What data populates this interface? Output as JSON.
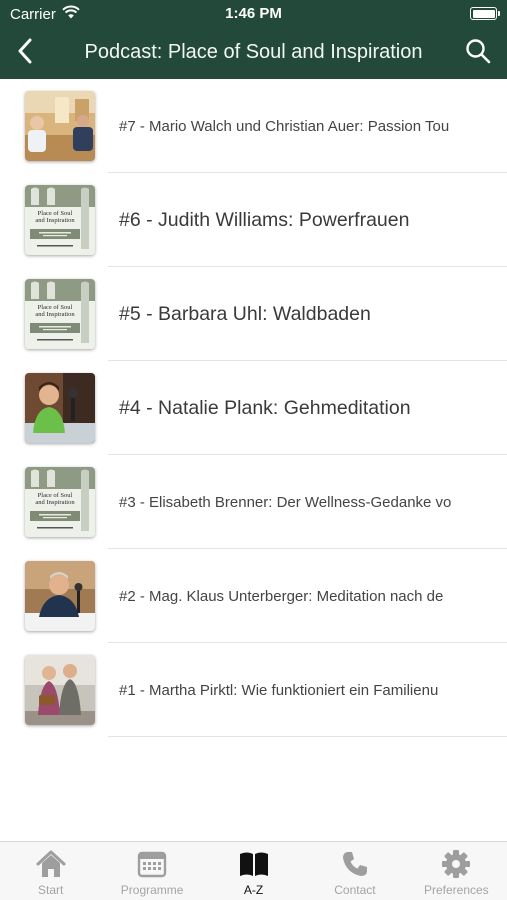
{
  "status_bar": {
    "carrier": "Carrier",
    "time": "1:46 PM"
  },
  "nav": {
    "title": "Podcast: Place of Soul and Inspiration",
    "back_icon": "chevron-left-icon",
    "search_icon": "search-icon"
  },
  "episodes": [
    {
      "title": "#7 - Mario Walch und Christian Auer: Passion Tou",
      "thumbnail": "photo-men-restaurant"
    },
    {
      "title": "#6 - Judith Williams: Powerfrauen",
      "thumbnail": "podcast-cover"
    },
    {
      "title": "#5 - Barbara Uhl: Waldbaden",
      "thumbnail": "podcast-cover"
    },
    {
      "title": "#4 - Natalie Plank: Gehmeditation",
      "thumbnail": "photo-woman-microphone"
    },
    {
      "title": "#3 - Elisabeth Brenner: Der Wellness-Gedanke vo",
      "thumbnail": "podcast-cover"
    },
    {
      "title": "#2 - Mag. Klaus Unterberger: Meditation nach de",
      "thumbnail": "photo-man-microphone"
    },
    {
      "title": "#1 - Martha Pirktl: Wie funktioniert ein Familienu",
      "thumbnail": "photo-two-women"
    }
  ],
  "cover": {
    "line1": "Place of Soul",
    "line2": "and Inspiration"
  },
  "tabs": [
    {
      "label": "Start",
      "icon": "home-icon",
      "active": false
    },
    {
      "label": "Programme",
      "icon": "calendar-icon",
      "active": false
    },
    {
      "label": "A-Z",
      "icon": "book-icon",
      "active": true
    },
    {
      "label": "Contact",
      "icon": "phone-icon",
      "active": false
    },
    {
      "label": "Preferences",
      "icon": "gear-icon",
      "active": false
    }
  ],
  "colors": {
    "header": "#22493a",
    "tab_active": "#111111",
    "tab_inactive": "#a4a4a4"
  }
}
